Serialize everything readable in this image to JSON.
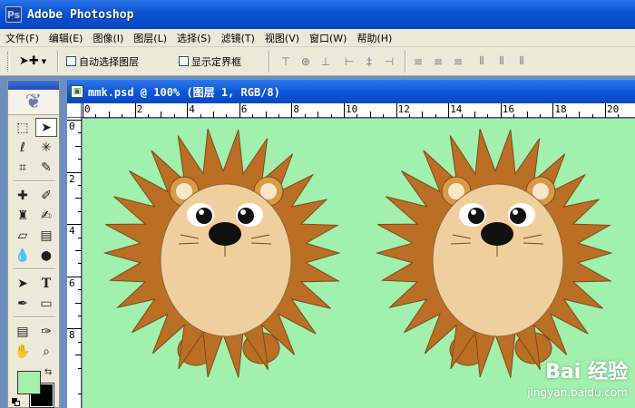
{
  "window": {
    "title": "Adobe Photoshop",
    "app_icon_glyph": "Ps"
  },
  "menu": [
    {
      "label": "文件(F)"
    },
    {
      "label": "编辑(E)"
    },
    {
      "label": "图像(I)"
    },
    {
      "label": "图层(L)"
    },
    {
      "label": "选择(S)"
    },
    {
      "label": "滤镜(T)"
    },
    {
      "label": "视图(V)"
    },
    {
      "label": "窗口(W)"
    },
    {
      "label": "帮助(H)"
    }
  ],
  "options_bar": {
    "auto_select_label": "自动选择图层",
    "show_bounds_label": "显示定界框",
    "auto_select_checked": false,
    "show_bounds_checked": false
  },
  "toolbox": {
    "foreground_color": "#a3f1ab",
    "background_color": "#000000"
  },
  "document": {
    "title": "mmk.psd @ 100% (图层 1, RGB/8)",
    "canvas_color": "#a1f0ad",
    "ruler_top_labels": [
      "0",
      "2",
      "4",
      "6",
      "8",
      "10",
      "12",
      "14",
      "16",
      "18",
      "20"
    ],
    "ruler_left_labels": [
      "0",
      "2",
      "4",
      "6",
      "8"
    ]
  },
  "watermark": {
    "main": "Bai 经验",
    "sub": "jingyan.baidu.com"
  }
}
